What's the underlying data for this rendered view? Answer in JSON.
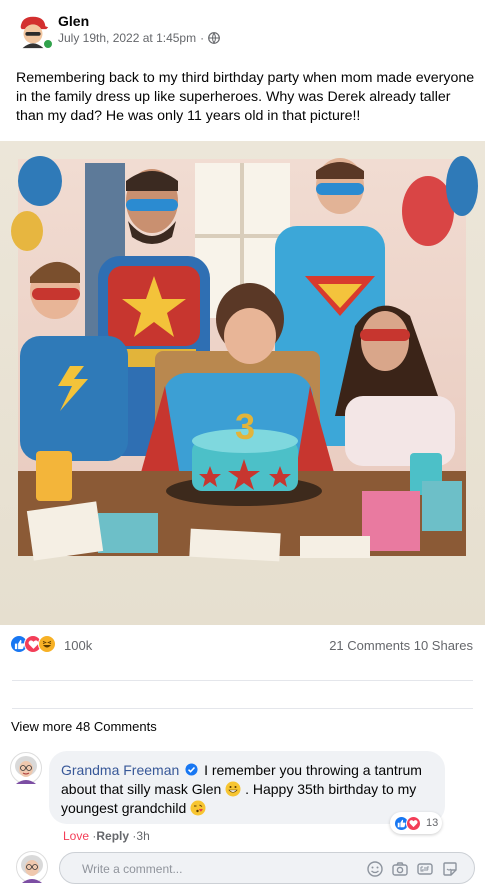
{
  "post": {
    "author": "Glen",
    "timestamp": "July 19th, 2022 at 1:45pm",
    "privacy_separator": "·",
    "text": "Remembering back to my third birthday party when mom made everyone in the family dress up like superheroes. Why was Derek already taller than my dad? He was only 11 years old in that picture!!",
    "cake_number": "3"
  },
  "reactions": {
    "icons": [
      "like-icon",
      "love-icon",
      "haha-icon"
    ],
    "count": "100k",
    "comments": "21 Comments",
    "shares": "10 Shares"
  },
  "comments_section": {
    "view_more": "View more 48 Comments",
    "comment": {
      "name": "Grandma Freeman",
      "text_part1": "I remember you throwing a tantrum about that silly mask Glen",
      "text_part2": ". Happy 35th birthday to my youngest grandchild",
      "reaction_count": "13",
      "love": "Love",
      "reply": "Reply",
      "sep": "·",
      "time": "3h"
    },
    "write": {
      "placeholder": "Write a comment..."
    }
  },
  "colors": {
    "like_blue": "#1877f2",
    "love_red": "#f33e58",
    "haha_yellow": "#f7b125",
    "name_link": "#385898",
    "online_green": "#31a24c"
  }
}
